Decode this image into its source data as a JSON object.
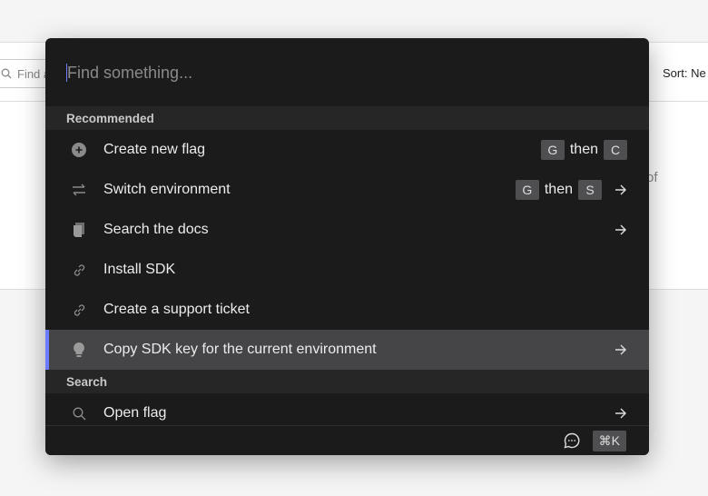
{
  "background": {
    "search_placeholder": "Find a",
    "sort_label": "Sort: Ne",
    "partial_text": "of"
  },
  "palette": {
    "search_placeholder": "Find something...",
    "accent": "#6b7cff",
    "sections": [
      {
        "title": "Recommended",
        "items": [
          {
            "label": "Create new flag",
            "icon": "plus-circle-icon",
            "shortcut": [
              "G",
              "then",
              "C"
            ],
            "arrow": false
          },
          {
            "label": "Switch environment",
            "icon": "swap-icon",
            "shortcut": [
              "G",
              "then",
              "S"
            ],
            "arrow": true
          },
          {
            "label": "Search the docs",
            "icon": "docs-icon",
            "arrow": true
          },
          {
            "label": "Install SDK",
            "icon": "link-icon",
            "arrow": false
          },
          {
            "label": "Create a support ticket",
            "icon": "link-icon",
            "arrow": false
          },
          {
            "label": "Copy SDK key for the current environment",
            "icon": "lightbulb-icon",
            "arrow": true,
            "selected": true
          }
        ]
      },
      {
        "title": "Search",
        "items": [
          {
            "label": "Open flag",
            "icon": "search-icon",
            "arrow": true
          }
        ]
      }
    ],
    "footer": {
      "shortcut": "⌘K",
      "icon": "chat-icon"
    }
  }
}
